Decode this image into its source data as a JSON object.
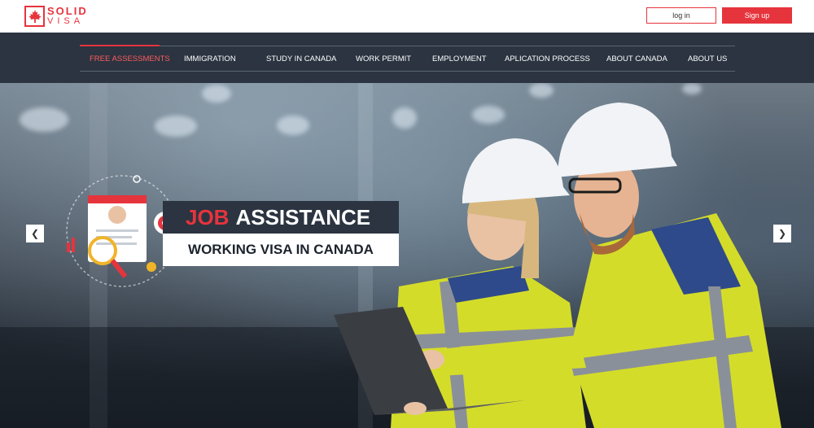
{
  "header": {
    "logo_line1": "SOLID",
    "logo_line2": "VISA",
    "login_label": "log in",
    "signup_label": "Sign up"
  },
  "nav": {
    "items": [
      {
        "label": "FREE ASSESSMENTS",
        "active": true
      },
      {
        "label": "IMMIGRATION",
        "active": false
      },
      {
        "label": "STUDY IN CANADA",
        "active": false
      },
      {
        "label": "WORK PERMIT",
        "active": false
      },
      {
        "label": "EMPLOYMENT",
        "active": false
      },
      {
        "label": "APLICATION PROCESS",
        "active": false
      },
      {
        "label": "ABOUT CANADA",
        "active": false
      },
      {
        "label": "ABOUT US",
        "active": false
      }
    ]
  },
  "hero": {
    "headline_red": "JOB",
    "headline_white": "ASSISTANCE",
    "subheadline": "WORKING VISA IN CANADA",
    "prev_icon": "chevron-left-icon",
    "next_icon": "chevron-right-icon"
  },
  "colors": {
    "brand_red": "#e6343d",
    "nav_bg": "#2b3440",
    "text_white": "#ffffff"
  }
}
